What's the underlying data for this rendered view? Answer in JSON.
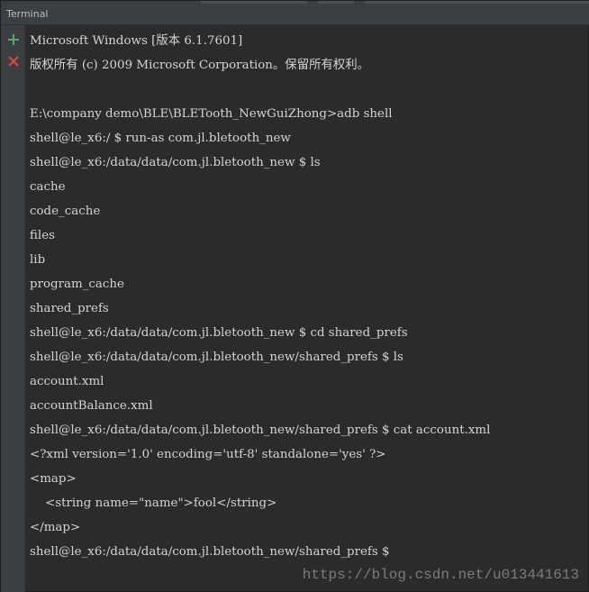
{
  "window": {
    "title": "Terminal"
  },
  "gutter": {
    "add_icon": "plus-icon",
    "close_icon": "close-icon",
    "add_color": "#59a869",
    "close_color": "#e0443e"
  },
  "console": {
    "lines": [
      "Microsoft Windows [版本 6.1.7601]",
      "版权所有 (c) 2009 Microsoft Corporation。保留所有权利。",
      "",
      "E:\\company demo\\BLE\\BLETooth_NewGuiZhong>adb shell",
      "shell@le_x6:/ $ run-as com.jl.bletooth_new",
      "shell@le_x6:/data/data/com.jl.bletooth_new $ ls",
      "cache",
      "code_cache",
      "files",
      "lib",
      "program_cache",
      "shared_prefs",
      "shell@le_x6:/data/data/com.jl.bletooth_new $ cd shared_prefs",
      "shell@le_x6:/data/data/com.jl.bletooth_new/shared_prefs $ ls",
      "account.xml",
      "accountBalance.xml",
      "shell@le_x6:/data/data/com.jl.bletooth_new/shared_prefs $ cat account.xml",
      "<?xml version='1.0' encoding='utf-8' standalone='yes' ?>",
      "<map>",
      "    <string name=\"name\">fool</string>",
      "</map>",
      "shell@le_x6:/data/data/com.jl.bletooth_new/shared_prefs $"
    ]
  },
  "watermark": {
    "text": "https://blog.csdn.net/u013441613"
  }
}
